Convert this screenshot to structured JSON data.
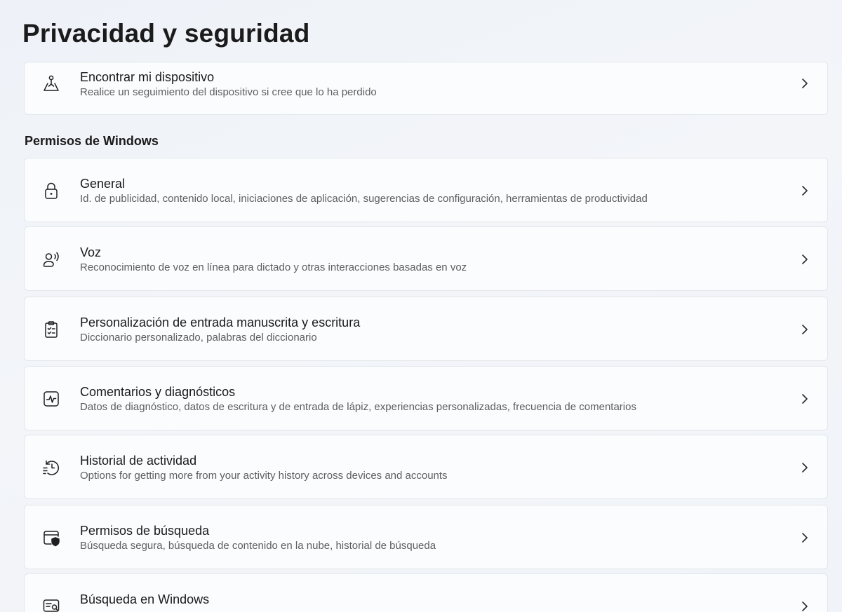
{
  "page": {
    "title": "Privacidad y seguridad"
  },
  "top_item": {
    "title": "Encontrar mi dispositivo",
    "description": "Realice un seguimiento del dispositivo si cree que lo ha perdido",
    "icon": "find-device-icon"
  },
  "section": {
    "header": "Permisos de Windows",
    "items": [
      {
        "title": "General",
        "description": "Id. de publicidad, contenido local, iniciaciones de aplicación, sugerencias de configuración, herramientas de productividad",
        "icon": "lock-icon"
      },
      {
        "title": "Voz",
        "description": "Reconocimiento de voz en línea para dictado y otras interacciones basadas en voz",
        "icon": "speech-icon"
      },
      {
        "title": "Personalización de entrada manuscrita y escritura",
        "description": "Diccionario personalizado, palabras del diccionario",
        "icon": "clipboard-checklist-icon"
      },
      {
        "title": "Comentarios y diagnósticos",
        "description": "Datos de diagnóstico, datos de escritura y de entrada de lápiz, experiencias personalizadas, frecuencia de comentarios",
        "icon": "pulse-monitor-icon"
      },
      {
        "title": "Historial de actividad",
        "description": "Options for getting more from your activity history across devices and accounts",
        "icon": "history-icon"
      },
      {
        "title": "Permisos de búsqueda",
        "description": "Búsqueda segura, búsqueda de contenido en la nube, historial de búsqueda",
        "icon": "search-shield-icon"
      },
      {
        "title": "Búsqueda en Windows",
        "description": "",
        "icon": "search-windows-icon"
      }
    ]
  },
  "colors": {
    "background": "#f0f3f8",
    "card": "#fbfcfd",
    "card_border": "#e3e6ea",
    "text_primary": "#1a1a1a",
    "text_secondary": "#5e5e5e"
  }
}
